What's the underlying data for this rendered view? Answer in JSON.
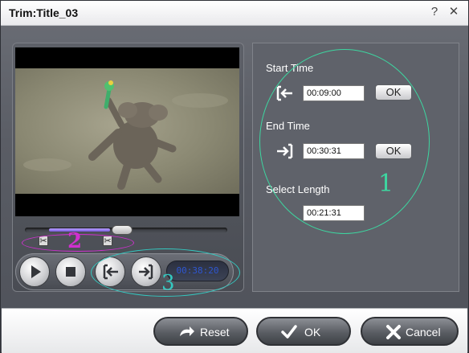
{
  "window": {
    "title": "Trim:Title_03",
    "help_label": "?",
    "close_label": "✕"
  },
  "player": {
    "time_display": "00:38:20",
    "slider_position": 0.47,
    "selection_start": 0.12,
    "selection_end": 0.42
  },
  "trim": {
    "start_label": "Start Time",
    "start_value": "00:09:00",
    "end_label": "End Time",
    "end_value": "00:30:31",
    "length_label": "Select Length",
    "length_value": "00:21:31",
    "ok_label": "OK"
  },
  "annotations": {
    "one": "1",
    "two": "2",
    "three": "3",
    "green": "#3dd6a0",
    "magenta": "#d030d0",
    "cyan": "#34c8c0"
  },
  "footer": {
    "reset_label": "Reset",
    "ok_label": "OK",
    "cancel_label": "Cancel"
  }
}
